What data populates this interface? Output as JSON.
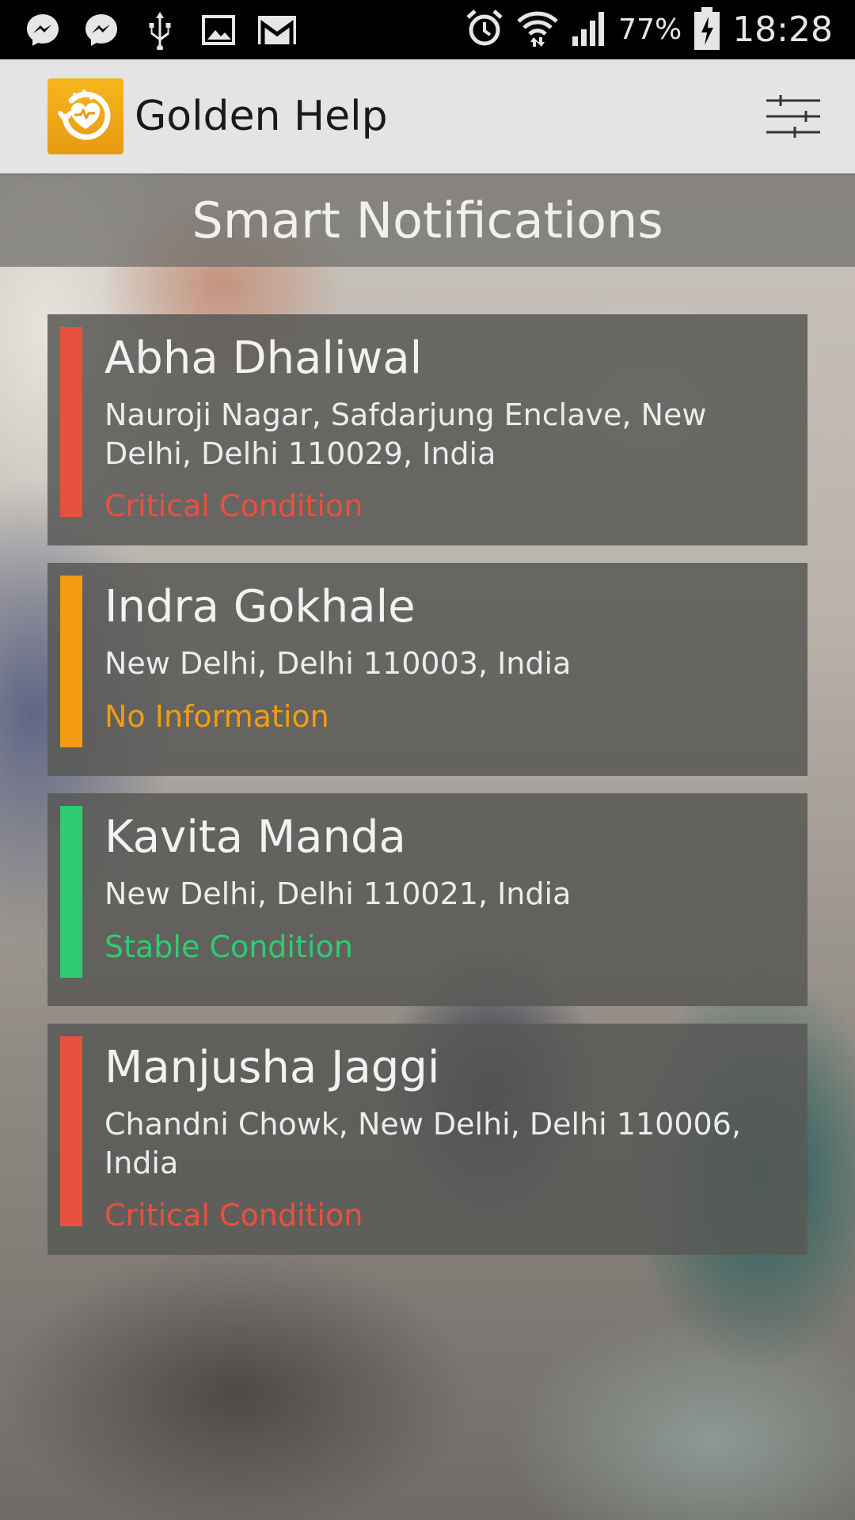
{
  "status_bar": {
    "battery_percent": "77%",
    "time": "18:28",
    "icons_left": [
      "messenger-icon",
      "messenger-icon",
      "usb-icon",
      "image-icon",
      "gmail-icon"
    ],
    "icons_right": [
      "alarm-icon",
      "wifi-icon",
      "signal-icon",
      "battery-charging-icon"
    ]
  },
  "app_bar": {
    "title": "Golden Help",
    "logo_icon": "heart-pulse-icon",
    "filter_icon": "sliders-icon"
  },
  "header": {
    "title": "Smart Notifications"
  },
  "colors": {
    "critical": "#e8513f",
    "no_info": "#f39c12",
    "stable": "#2ecc71"
  },
  "notifications": [
    {
      "name": "Abha Dhaliwal",
      "address": "Nauroji Nagar, Safdarjung Enclave, New Delhi, Delhi 110029, India",
      "status": "Critical Condition",
      "color": "#e8513f"
    },
    {
      "name": "Indra Gokhale",
      "address": "New Delhi, Delhi 110003, India",
      "status": "No Information",
      "color": "#f39c12"
    },
    {
      "name": "Kavita Manda",
      "address": "New Delhi, Delhi 110021, India",
      "status": "Stable Condition",
      "color": "#2ecc71"
    },
    {
      "name": "Manjusha Jaggi",
      "address": "Chandni Chowk, New Delhi, Delhi 110006, India",
      "status": "Critical Condition",
      "color": "#e8513f"
    }
  ]
}
